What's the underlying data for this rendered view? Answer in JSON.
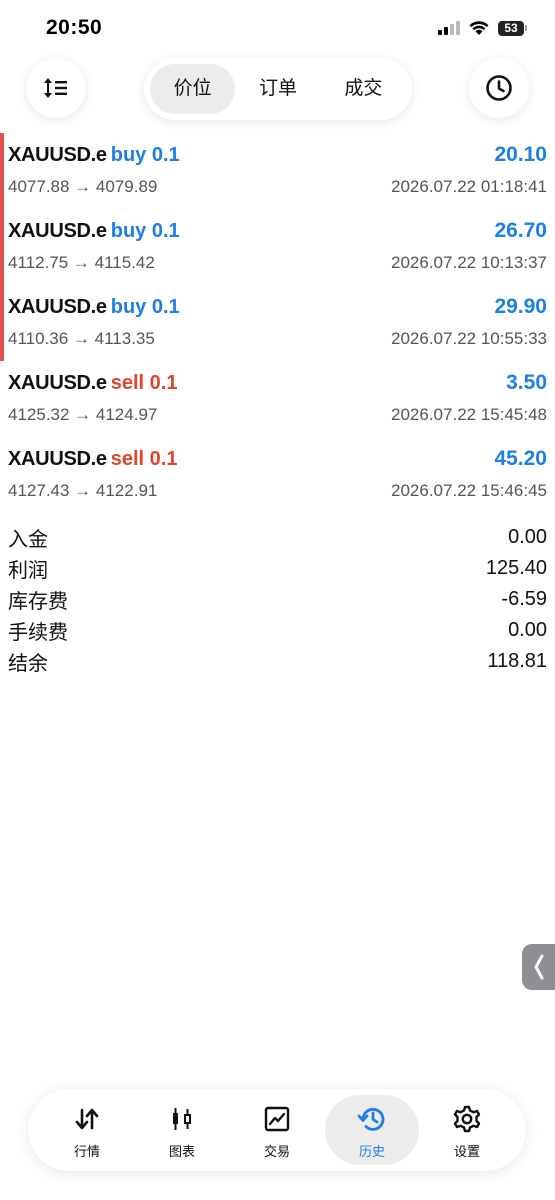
{
  "status_bar": {
    "time": "20:50",
    "battery": "53"
  },
  "toolbar": {
    "tabs": [
      {
        "label": "价位",
        "active": true
      },
      {
        "label": "订单",
        "active": false
      },
      {
        "label": "成交",
        "active": false
      }
    ],
    "left_icon": "sort-icon",
    "right_icon": "clock-icon"
  },
  "deals": [
    {
      "symbol": "XAUUSD.e",
      "side": "buy 0.1",
      "type": "buy",
      "profit": "20.10",
      "prices": "4077.88 → 4079.89",
      "time": "2026.07.22 01:18:41",
      "marked": true
    },
    {
      "symbol": "XAUUSD.e",
      "side": "buy 0.1",
      "type": "buy",
      "profit": "26.70",
      "prices": "4112.75 → 4115.42",
      "time": "2026.07.22 10:13:37",
      "marked": true
    },
    {
      "symbol": "XAUUSD.e",
      "side": "buy 0.1",
      "type": "buy",
      "profit": "29.90",
      "prices": "4110.36 → 4113.35",
      "time": "2026.07.22 10:55:33",
      "marked": true
    },
    {
      "symbol": "XAUUSD.e",
      "side": "sell 0.1",
      "type": "sell",
      "profit": "3.50",
      "prices": "4125.32 → 4124.97",
      "time": "2026.07.22 15:45:48",
      "marked": false
    },
    {
      "symbol": "XAUUSD.e",
      "side": "sell 0.1",
      "type": "sell",
      "profit": "45.20",
      "prices": "4127.43 → 4122.91",
      "time": "2026.07.22 15:46:45",
      "marked": false
    }
  ],
  "summary": [
    {
      "label": "入金",
      "value": "0.00"
    },
    {
      "label": "利润",
      "value": "125.40"
    },
    {
      "label": "库存费",
      "value": "-6.59"
    },
    {
      "label": "手续费",
      "value": "0.00"
    },
    {
      "label": "结余",
      "value": "118.81"
    }
  ],
  "tabbar": {
    "items": [
      {
        "label": "行情",
        "icon": "quotes-icon",
        "active": false
      },
      {
        "label": "图表",
        "icon": "chart-icon",
        "active": false
      },
      {
        "label": "交易",
        "icon": "trade-icon",
        "active": false
      },
      {
        "label": "历史",
        "icon": "history-icon",
        "active": true
      },
      {
        "label": "设置",
        "icon": "settings-icon",
        "active": false
      }
    ]
  },
  "colors": {
    "buy": "#1a7fe8",
    "sell": "#e0452f",
    "profit": "#1a7fe8",
    "marker": "#e05252"
  }
}
